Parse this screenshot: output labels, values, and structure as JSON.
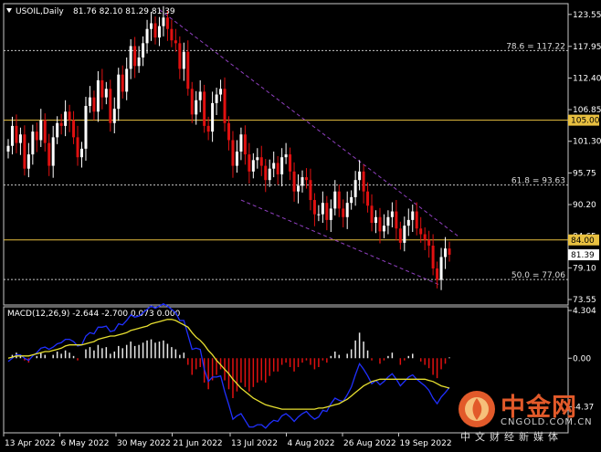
{
  "chart_title": "USOIL,Daily",
  "ohlc_label": "81.76 82.10 81.29 81.39",
  "macd_label": "MACD(12,26,9) -2.644 -2.700 0.073 0.000",
  "watermark": {
    "name": "中金网",
    "domain": "CNGOLD.COM.CN",
    "subtitle": "中文财经新媒体"
  },
  "colors": {
    "bg": "#000000",
    "up": "#ffffff",
    "down": "#e01010",
    "grid": "#c8c8c8",
    "hline": "#e8c040",
    "channel": "#9040c0",
    "macd_signal": "#e8e030",
    "macd_line": "#2030ff"
  },
  "chart_data": [
    {
      "type": "candlestick",
      "title": "USOIL,Daily",
      "ylim": [
        73.55,
        124.8
      ],
      "y_ticks": [
        "123.55",
        "117.95",
        "112.40",
        "106.85",
        "101.30",
        "95.75",
        "90.20",
        "84.65",
        "79.10",
        "73.55"
      ],
      "x_ticks": [
        "13 Apr 2022",
        "6 May 2022",
        "30 May 2022",
        "21 Jun 2022",
        "13 Jul 2022",
        "4 Aug 2022",
        "26 Aug 2022",
        "19 Sep 2022"
      ],
      "levels": [
        {
          "value": 117.22,
          "label": "78.6 = 117.22",
          "style": "fib"
        },
        {
          "value": 105.0,
          "label": "105.00",
          "style": "tag"
        },
        {
          "value": 93.63,
          "label": "61.8 = 93.63",
          "style": "fib"
        },
        {
          "value": 84.0,
          "label": "84.00",
          "style": "tag"
        },
        {
          "value": 77.06,
          "label": "50.0 = 77.06",
          "style": "fib"
        }
      ],
      "current_price": {
        "value": 81.39,
        "label": "81.39"
      },
      "closes": [
        100.5,
        104.0,
        101.0,
        102.5,
        96.5,
        99.0,
        103.0,
        101.5,
        105.0,
        101.0,
        97.0,
        102.0,
        104.5,
        104.0,
        106.5,
        105.0,
        102.0,
        98.5,
        100.0,
        107.5,
        109.0,
        106.5,
        112.0,
        109.0,
        110.5,
        104.5,
        107.0,
        113.0,
        110.0,
        114.0,
        118.0,
        114.5,
        116.0,
        118.5,
        121.0,
        122.0,
        119.5,
        121.5,
        123.0,
        121.0,
        119.0,
        118.5,
        114.0,
        117.0,
        110.5,
        106.0,
        108.5,
        110.0,
        104.0,
        103.0,
        108.0,
        109.5,
        110.5,
        104.5,
        101.5,
        97.0,
        99.5,
        102.5,
        99.0,
        96.0,
        98.0,
        98.5,
        97.0,
        94.5,
        96.5,
        97.5,
        95.5,
        98.5,
        99.0,
        96.0,
        92.5,
        93.5,
        95.0,
        94.5,
        91.0,
        88.5,
        88.5,
        90.5,
        87.5,
        89.5,
        92.5,
        89.5,
        88.0,
        90.5,
        91.5,
        94.5,
        96.0,
        92.5,
        90.0,
        87.0,
        88.0,
        85.5,
        86.5,
        88.0,
        89.0,
        86.0,
        83.5,
        86.5,
        87.5,
        89.0,
        86.0,
        85.0,
        84.0,
        83.0,
        79.0,
        77.0,
        81.0,
        82.5,
        81.4
      ],
      "macd_pane": {
        "label": "MACD(12,26,9) -2.644 -2.700 0.073 0.000",
        "ylim": [
          -6.4,
          4.304
        ],
        "y_ticks": [
          "4.304",
          "0.00",
          "-4.37"
        ],
        "histogram": [
          0.0,
          0.3,
          0.5,
          0.2,
          -0.2,
          -0.4,
          0.0,
          0.2,
          0.5,
          0.3,
          0.0,
          0.3,
          0.6,
          0.4,
          0.7,
          0.5,
          0.2,
          -0.2,
          0.0,
          0.8,
          1.0,
          0.7,
          1.2,
          0.9,
          1.0,
          0.4,
          0.6,
          1.1,
          0.9,
          1.2,
          1.5,
          1.1,
          1.2,
          1.4,
          1.6,
          1.7,
          1.4,
          1.5,
          1.6,
          1.3,
          1.0,
          0.8,
          0.3,
          0.5,
          -0.6,
          -1.5,
          -1.0,
          -0.8,
          -2.2,
          -2.8,
          -2.0,
          -1.5,
          -1.0,
          -2.0,
          -2.8,
          -3.6,
          -3.0,
          -2.2,
          -2.6,
          -3.0,
          -2.6,
          -2.2,
          -2.0,
          -2.2,
          -1.6,
          -1.2,
          -1.2,
          -0.6,
          -0.4,
          -0.8,
          -1.2,
          -0.8,
          -0.4,
          -0.2,
          -0.6,
          -1.0,
          -0.8,
          -0.2,
          -0.4,
          0.2,
          0.6,
          0.3,
          0.0,
          0.4,
          0.8,
          1.6,
          2.3,
          1.5,
          0.7,
          -0.2,
          0.0,
          -0.5,
          -0.2,
          0.2,
          0.5,
          0.0,
          -0.6,
          -0.2,
          0.2,
          0.4,
          0.0,
          -0.3,
          -0.6,
          -0.9,
          -1.5,
          -1.8,
          -1.0,
          -0.5,
          0.07
        ],
        "signal": [
          0.0,
          0.1,
          0.2,
          0.2,
          0.2,
          0.2,
          0.3,
          0.4,
          0.5,
          0.6,
          0.6,
          0.7,
          0.8,
          0.9,
          1.1,
          1.2,
          1.2,
          1.2,
          1.2,
          1.3,
          1.4,
          1.5,
          1.7,
          1.8,
          1.9,
          2.0,
          2.0,
          2.1,
          2.2,
          2.3,
          2.5,
          2.6,
          2.7,
          2.8,
          2.9,
          3.1,
          3.2,
          3.3,
          3.4,
          3.5,
          3.5,
          3.4,
          3.2,
          3.0,
          2.8,
          2.3,
          1.9,
          1.6,
          1.2,
          0.7,
          0.3,
          -0.2,
          -0.6,
          -1.0,
          -1.4,
          -1.9,
          -2.3,
          -2.7,
          -3.0,
          -3.3,
          -3.6,
          -3.8,
          -4.0,
          -4.2,
          -4.3,
          -4.4,
          -4.5,
          -4.6,
          -4.6,
          -4.6,
          -4.6,
          -4.6,
          -4.6,
          -4.6,
          -4.6,
          -4.6,
          -4.5,
          -4.5,
          -4.4,
          -4.3,
          -4.2,
          -4.1,
          -3.9,
          -3.7,
          -3.4,
          -3.1,
          -2.8,
          -2.5,
          -2.3,
          -2.1,
          -2.0,
          -1.9,
          -1.9,
          -1.9,
          -1.9,
          -1.9,
          -1.9,
          -1.9,
          -1.9,
          -1.9,
          -1.9,
          -1.9,
          -1.9,
          -2.0,
          -2.1,
          -2.3,
          -2.5,
          -2.6,
          -2.7
        ],
        "macd": [
          -0.3,
          0.0,
          0.3,
          0.3,
          0.0,
          -0.2,
          0.2,
          0.5,
          0.9,
          1.0,
          0.8,
          1.0,
          1.3,
          1.4,
          1.7,
          1.7,
          1.5,
          1.1,
          1.2,
          2.0,
          2.3,
          2.2,
          2.8,
          2.8,
          2.9,
          2.4,
          2.5,
          3.1,
          3.0,
          3.4,
          3.9,
          3.7,
          3.8,
          4.1,
          4.4,
          4.7,
          4.5,
          4.7,
          4.9,
          4.7,
          4.4,
          4.1,
          3.4,
          3.4,
          2.1,
          0.8,
          0.9,
          0.8,
          -1.0,
          -2.1,
          -1.7,
          -1.7,
          -1.6,
          -3.0,
          -4.2,
          -5.5,
          -5.2,
          -5.0,
          -5.6,
          -6.2,
          -6.2,
          -6.0,
          -6.0,
          -6.3,
          -5.9,
          -5.6,
          -5.7,
          -5.2,
          -5.0,
          -5.3,
          -5.7,
          -5.3,
          -5.0,
          -4.8,
          -5.2,
          -5.5,
          -5.3,
          -4.7,
          -4.8,
          -4.1,
          -3.6,
          -3.8,
          -3.9,
          -3.3,
          -2.6,
          -1.5,
          -0.5,
          -1.0,
          -1.6,
          -2.3,
          -2.0,
          -2.4,
          -2.1,
          -1.7,
          -1.4,
          -1.9,
          -2.5,
          -2.1,
          -1.7,
          -1.5,
          -1.9,
          -2.2,
          -2.5,
          -2.9,
          -3.6,
          -4.1,
          -3.5,
          -3.1,
          -2.64
        ]
      }
    }
  ]
}
